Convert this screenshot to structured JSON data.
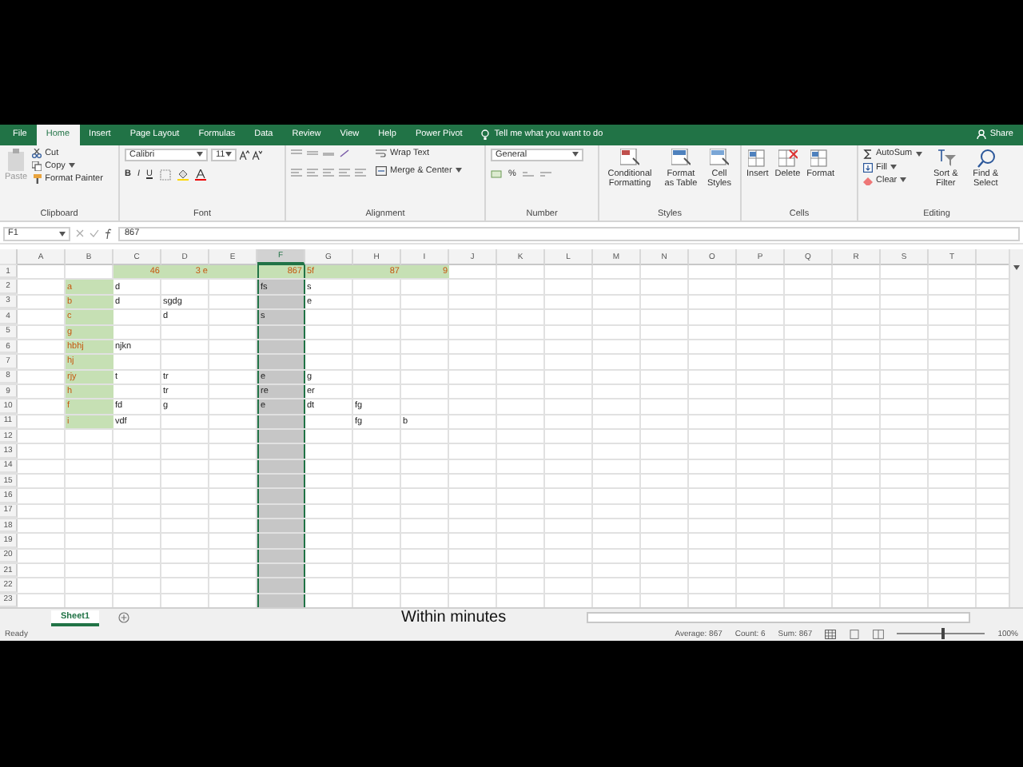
{
  "ribbon_tabs": [
    {
      "label": "File",
      "selected": false
    },
    {
      "label": "Home",
      "selected": true
    },
    {
      "label": "Insert",
      "selected": false
    },
    {
      "label": "Page Layout",
      "selected": false
    },
    {
      "label": "Formulas",
      "selected": false
    },
    {
      "label": "Data",
      "selected": false
    },
    {
      "label": "Review",
      "selected": false
    },
    {
      "label": "View",
      "selected": false
    },
    {
      "label": "Help",
      "selected": false
    },
    {
      "label": "Power Pivot",
      "selected": false
    }
  ],
  "tell_me": "Tell me what you want to do",
  "share": "Share",
  "clipboard": {
    "label": "Clipboard",
    "paste": "Paste",
    "cut": "Cut",
    "copy": "Copy",
    "format_painter": "Format Painter"
  },
  "font": {
    "label": "Font",
    "font_name": "Calibri",
    "font_size": "11",
    "bold": "B",
    "italic": "I",
    "underline": "U"
  },
  "alignment": {
    "label": "Alignment",
    "wrap_text": "Wrap Text",
    "merge_center": "Merge & Center"
  },
  "number": {
    "label": "Number",
    "format": "General",
    "percent": "%"
  },
  "styles": {
    "label": "Styles",
    "buttons": [
      "Conditional Formatting",
      "Format as Table",
      "Cell Styles"
    ]
  },
  "cells": {
    "label": "Cells",
    "buttons": [
      "Insert",
      "Delete",
      "Format"
    ]
  },
  "editing": {
    "label": "Editing",
    "autosum": "AutoSum",
    "fill": "Fill",
    "clear": "Clear",
    "buttons": [
      "Sort & Filter",
      "Find & Select"
    ]
  },
  "formula_bar": {
    "name_box": "F1",
    "formula": "867"
  },
  "columns": [
    {
      "label": "A",
      "selected": false
    },
    {
      "label": "B",
      "selected": false
    },
    {
      "label": "C",
      "selected": false
    },
    {
      "label": "D",
      "selected": false
    },
    {
      "label": "E",
      "selected": false
    },
    {
      "label": "F",
      "selected": true
    },
    {
      "label": "G",
      "selected": false
    },
    {
      "label": "H",
      "selected": false
    },
    {
      "label": "I",
      "selected": false
    },
    {
      "label": "J",
      "selected": false
    },
    {
      "label": "K",
      "selected": false
    },
    {
      "label": "L",
      "selected": false
    },
    {
      "label": "M",
      "selected": false
    },
    {
      "label": "N",
      "selected": false
    },
    {
      "label": "O",
      "selected": false
    },
    {
      "label": "P",
      "selected": false
    },
    {
      "label": "Q",
      "selected": false
    },
    {
      "label": "R",
      "selected": false
    },
    {
      "label": "S",
      "selected": false
    },
    {
      "label": "T",
      "selected": false
    }
  ],
  "rows": [
    {
      "label": "1",
      "cells": [
        null,
        null,
        {
          "text": "46",
          "kind": "number",
          "highlight": true
        },
        {
          "text": "3 e",
          "kind": "number",
          "highlight": true
        },
        {
          "kind": "text",
          "highlight": true
        },
        {
          "text": "867",
          "kind": "number",
          "highlight": true
        },
        {
          "text": "5f",
          "kind": "text",
          "highlight": true
        },
        {
          "text": "87",
          "kind": "number",
          "highlight": true
        },
        {
          "text": "9",
          "kind": "number",
          "highlight": true
        }
      ]
    },
    {
      "label": "2",
      "cells": [
        null,
        {
          "text": "a",
          "kind": "text",
          "highlight": true
        },
        {
          "text": "d",
          "kind": "text",
          "highlight": false
        },
        null,
        null,
        {
          "text": "fs",
          "kind": "text",
          "highlight": false
        },
        {
          "text": "s",
          "kind": "text",
          "highlight": false
        }
      ]
    },
    {
      "label": "3",
      "cells": [
        null,
        {
          "text": "b",
          "kind": "text",
          "highlight": true
        },
        {
          "text": "d",
          "kind": "text",
          "highlight": false
        },
        {
          "text": "sgdg",
          "kind": "text",
          "highlight": false
        },
        null,
        null,
        {
          "text": "e",
          "kind": "text",
          "highlight": false
        }
      ]
    },
    {
      "label": "4",
      "cells": [
        null,
        {
          "text": "c",
          "kind": "text",
          "highlight": true
        },
        null,
        {
          "text": "d",
          "kind": "text",
          "highlight": false
        },
        null,
        {
          "text": "s",
          "kind": "text",
          "highlight": false
        }
      ]
    },
    {
      "label": "5",
      "cells": [
        null,
        {
          "text": "g",
          "kind": "text",
          "highlight": true
        }
      ]
    },
    {
      "label": "6",
      "cells": [
        null,
        {
          "text": "hbhj",
          "kind": "text",
          "highlight": true
        },
        {
          "text": "njkn",
          "kind": "text",
          "highlight": false
        }
      ]
    },
    {
      "label": "7",
      "cells": [
        null,
        {
          "text": "hj",
          "kind": "text",
          "highlight": true
        }
      ]
    },
    {
      "label": "8",
      "cells": [
        null,
        {
          "text": "rjy",
          "kind": "text",
          "highlight": true
        },
        {
          "text": "t",
          "kind": "text",
          "highlight": false
        },
        {
          "text": "tr",
          "kind": "text",
          "highlight": false
        },
        null,
        {
          "text": "e",
          "kind": "text",
          "highlight": false
        },
        {
          "text": "g",
          "kind": "text",
          "highlight": false
        }
      ]
    },
    {
      "label": "9",
      "cells": [
        null,
        {
          "text": "h",
          "kind": "text",
          "highlight": true
        },
        null,
        {
          "text": "tr",
          "kind": "text",
          "highlight": false
        },
        null,
        {
          "text": "re",
          "kind": "text",
          "highlight": false
        },
        {
          "text": "er",
          "kind": "text",
          "highlight": false
        }
      ]
    },
    {
      "label": "10",
      "cells": [
        null,
        {
          "text": "f",
          "kind": "text",
          "highlight": true
        },
        {
          "text": "fd",
          "kind": "text",
          "highlight": false
        },
        {
          "text": "g",
          "kind": "text",
          "highlight": false
        },
        null,
        {
          "text": "e",
          "kind": "text",
          "highlight": false
        },
        {
          "text": "dt",
          "kind": "text",
          "highlight": false
        },
        {
          "text": "fg",
          "kind": "text",
          "highlight": false
        }
      ]
    },
    {
      "label": "11",
      "cells": [
        null,
        {
          "text": "i",
          "kind": "text",
          "highlight": true
        },
        {
          "text": "vdf",
          "kind": "text",
          "highlight": false
        },
        null,
        null,
        null,
        null,
        {
          "text": "fg",
          "kind": "text",
          "highlight": false
        },
        {
          "text": "b",
          "kind": "text",
          "highlight": false
        }
      ]
    },
    {
      "label": "12"
    },
    {
      "label": "13"
    },
    {
      "label": "14"
    },
    {
      "label": "15"
    },
    {
      "label": "16"
    },
    {
      "label": "17"
    },
    {
      "label": "18"
    },
    {
      "label": "19"
    },
    {
      "label": "20"
    },
    {
      "label": "21"
    },
    {
      "label": "22"
    },
    {
      "label": "23"
    }
  ],
  "sheet_tabs": [
    {
      "label": "Sheet1",
      "selected": true
    }
  ],
  "caption": "Within minutes",
  "status_bar": {
    "mode": "Ready",
    "average": "Average: 867",
    "count": "Count: 6",
    "sum": "Sum: 867",
    "zoom": "100%",
    "zoom_slider": {
      "level": 0.5
    }
  }
}
